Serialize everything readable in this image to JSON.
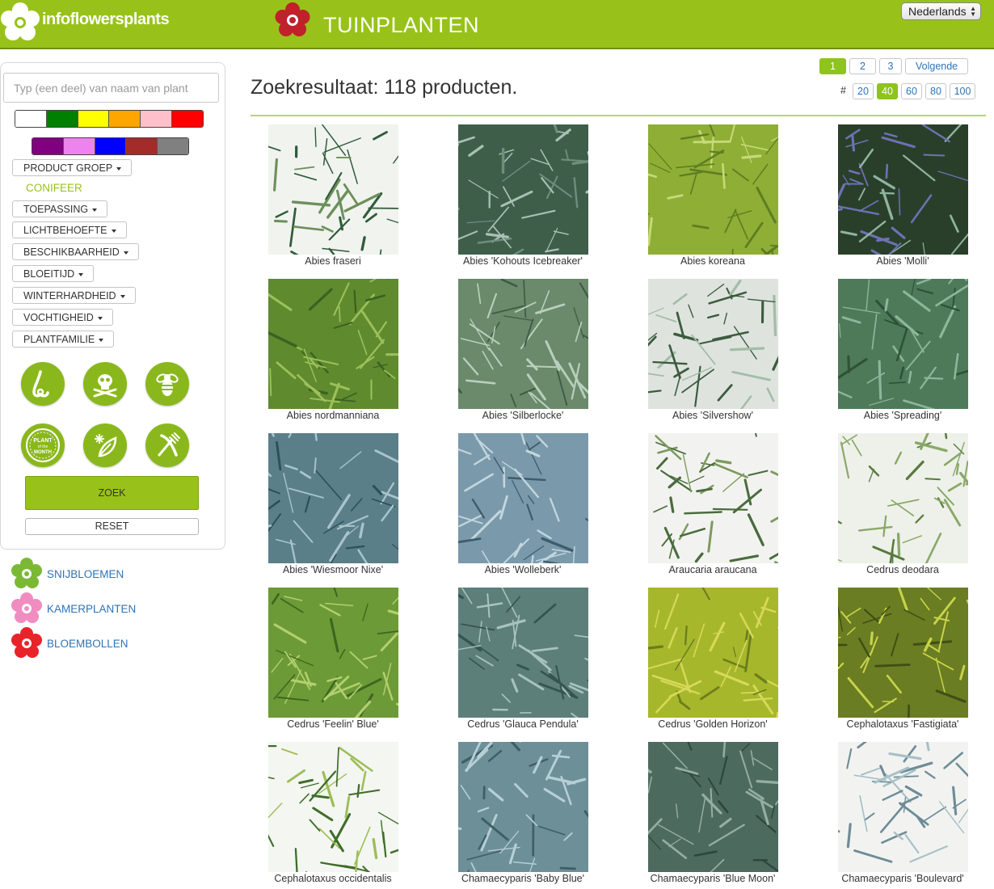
{
  "header": {
    "brand": "infoflowersplants",
    "section_title": "TUINPLANTEN",
    "language": "Nederlands"
  },
  "sidebar": {
    "search_placeholder": "Typ (een deel) van naam van plant",
    "color_swatches_row1": [
      "#ffffff",
      "#008000",
      "#ffff00",
      "#ffa500",
      "#ffc0cb",
      "#ff0000"
    ],
    "color_swatches_row2": [
      "#800080",
      "#ee82ee",
      "#0000ff",
      "#a52a2a",
      "#808080"
    ],
    "filters": [
      {
        "label": "PRODUCT GROEP"
      },
      {
        "label": "TOEPASSING"
      },
      {
        "label": "LICHTBEHOEFTE"
      },
      {
        "label": "BESCHIKBAARHEID"
      },
      {
        "label": "BLOEITIJD"
      },
      {
        "label": "WINTERHARDHEID"
      },
      {
        "label": "VOCHTIGHEID"
      },
      {
        "label": "PLANTFAMILIE"
      }
    ],
    "selected_product_group": "CONIFEER",
    "property_icons": [
      "fragrance-nose-icon",
      "poison-skull-icon",
      "bee-icon",
      "plant-of-the-month-icon",
      "frost-leaf-icon",
      "edible-cutlery-icon"
    ],
    "plant_of_month_text": [
      "PLANT",
      "of the",
      "MONTH"
    ],
    "search_button": "ZOEK",
    "reset_button": "RESET",
    "categories": [
      {
        "label": "SNIJBLOEMEN",
        "color": "#7bb935"
      },
      {
        "label": "KAMERPLANTEN",
        "color": "#f08cc0"
      },
      {
        "label": "BLOEMBOLLEN",
        "color": "#e8232a"
      }
    ]
  },
  "main": {
    "results_title": "Zoekresultaat: 118 producten.",
    "pages": [
      "1",
      "2",
      "3"
    ],
    "next_label": "Volgende",
    "active_page": "1",
    "per_page_label": "#",
    "per_page_options": [
      "20",
      "40",
      "60",
      "80",
      "100"
    ],
    "active_per_page": "40",
    "products": [
      "Abies fraseri",
      "Abies 'Kohouts Icebreaker'",
      "Abies koreana",
      "Abies 'Molli'",
      "Abies nordmanniana",
      "Abies 'Silberlocke'",
      "Abies 'Silvershow'",
      "Abies 'Spreading'",
      "Abies 'Wiesmoor Nixe'",
      "Abies 'Wolleberk'",
      "Araucaria araucana",
      "Cedrus deodara",
      "Cedrus 'Feelin' Blue'",
      "Cedrus 'Glauca Pendula'",
      "Cedrus 'Golden Horizon'",
      "Cephalotaxus 'Fastigiata'",
      "Cephalotaxus occidentalis",
      "Chamaecyparis 'Baby Blue'",
      "Chamaecyparis 'Blue Moon'",
      "Chamaecyparis 'Boulevard'"
    ],
    "product_palettes": [
      [
        "#f1f3ef",
        "#2f5b3a",
        "#6c8f5a"
      ],
      [
        "#3f5e4a",
        "#a9c1b4",
        "#6e8f7d"
      ],
      [
        "#8fae35",
        "#5e7d22",
        "#c7d978"
      ],
      [
        "#2a3f2a",
        "#6d72b5",
        "#8fb3a0"
      ],
      [
        "#5f8a2e",
        "#9cc05a",
        "#3b6122"
      ],
      [
        "#6a8a6b",
        "#b9cfbd",
        "#3e5c45"
      ],
      [
        "#dfe3de",
        "#3a5c3e",
        "#a3bda7"
      ],
      [
        "#4e7a5a",
        "#8db69a",
        "#2e5238"
      ],
      [
        "#5a7f88",
        "#a9c4cc",
        "#2f4e55"
      ],
      [
        "#7a9aab",
        "#c3d6df",
        "#3e5d6c"
      ],
      [
        "#f2f3f0",
        "#4a6b3c",
        "#7d9a5f"
      ],
      [
        "#eef1ea",
        "#8aa868",
        "#587a3e"
      ],
      [
        "#6c9a36",
        "#b2cf6e",
        "#3d6520"
      ],
      [
        "#5c7f7a",
        "#a8c3bf",
        "#345450"
      ],
      [
        "#a7b72c",
        "#d7d95a",
        "#6c7d1d"
      ],
      [
        "#6b7d22",
        "#c7d44a",
        "#3e4f16"
      ],
      [
        "#f4f6f1",
        "#3f6d2a",
        "#9dbd57"
      ],
      [
        "#6d8f98",
        "#b6cfd6",
        "#3f5f66"
      ],
      [
        "#4d6a5f",
        "#93aea4",
        "#2e463e"
      ],
      [
        "#f2f3f1",
        "#6e8c96",
        "#a8c0c7"
      ]
    ]
  }
}
